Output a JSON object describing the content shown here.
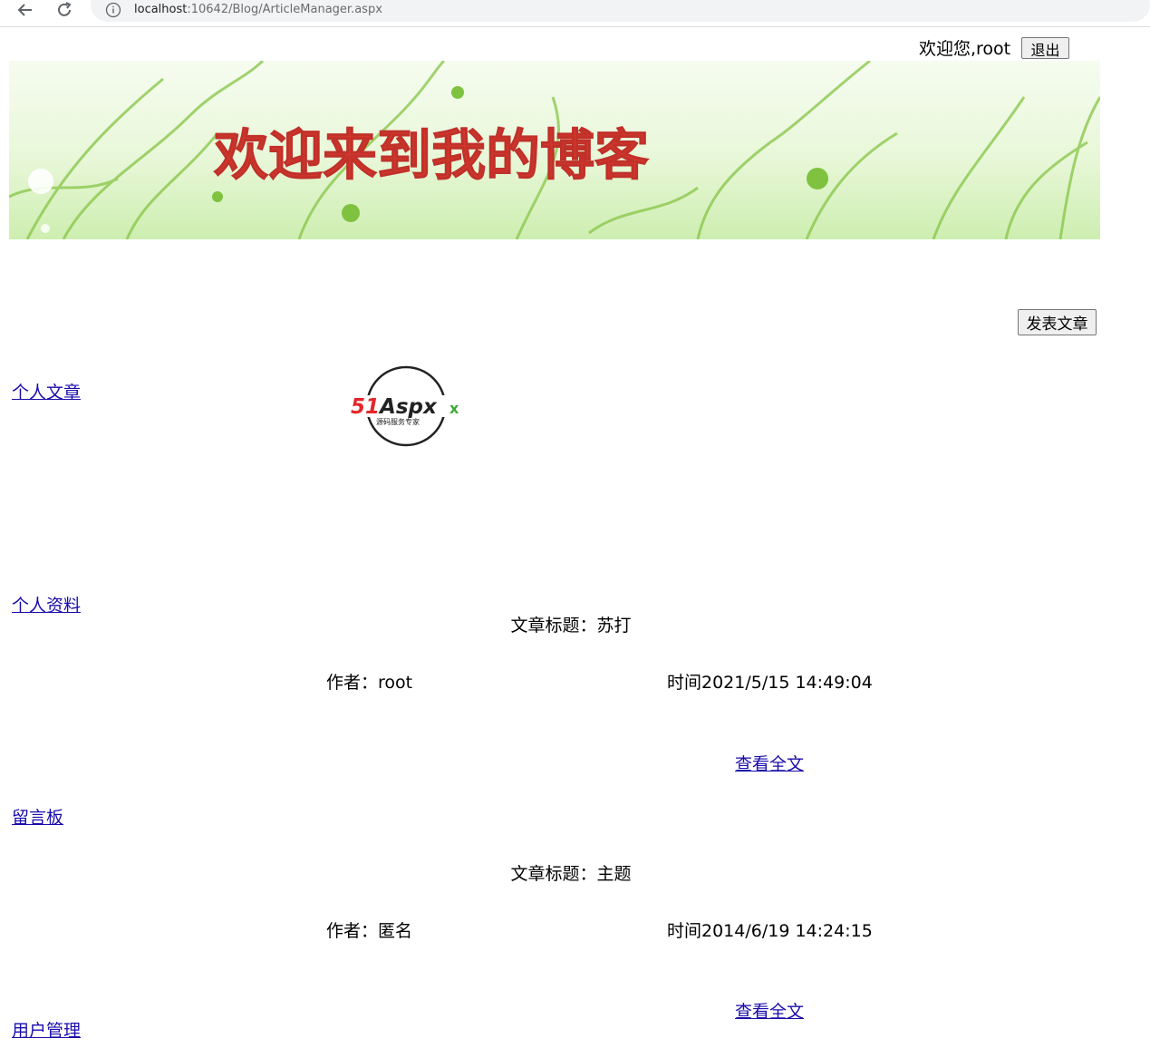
{
  "browser": {
    "url_host": "localhost",
    "url_rest": ":10642/Blog/ArticleManager.aspx"
  },
  "header": {
    "welcome_text": "欢迎您,root",
    "logout_label": "退出"
  },
  "banner": {
    "text": "欢迎来到我的博客",
    "text_color": "#d0362c",
    "bg_color": "#e3f5cf"
  },
  "toolbar": {
    "post_label": "发表文章"
  },
  "sidebar": {
    "items": [
      {
        "label": "个人文章"
      },
      {
        "label": "个人资料"
      },
      {
        "label": "留言板"
      },
      {
        "label": "用户管理"
      }
    ]
  },
  "logo": {
    "brand": "51Aspx",
    "tagline": "源码服务专家"
  },
  "articles": [
    {
      "title": "文章标题：苏打",
      "author": "作者：root",
      "time": "时间2021/5/15 14:49:04",
      "link": "查看全文"
    },
    {
      "title": "文章标题：主题",
      "author": "作者：匿名",
      "time": "时间2014/6/19 14:24:15",
      "link": "查看全文"
    }
  ],
  "colors": {
    "link": "#1a0dab",
    "logo_red": "#e4262a",
    "logo_green": "#3aa935"
  }
}
